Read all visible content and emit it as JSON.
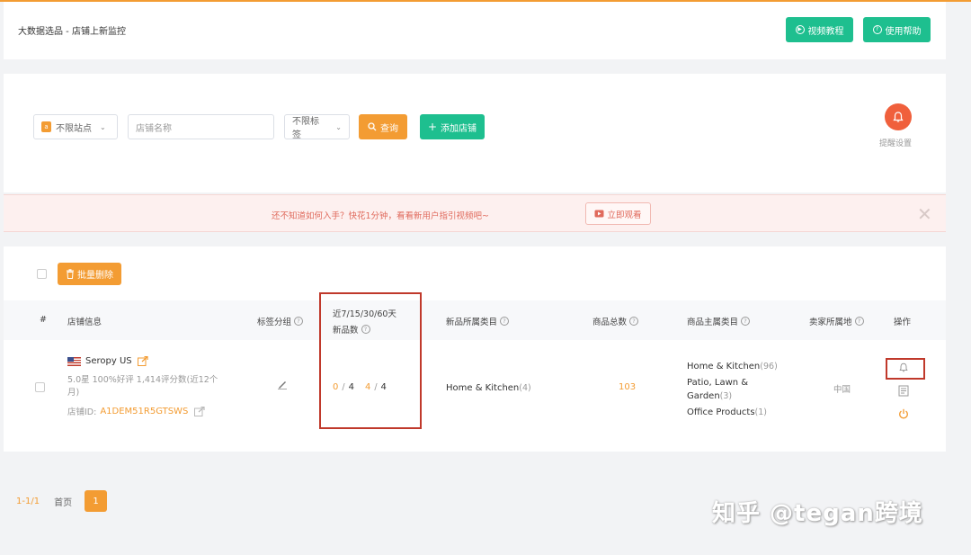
{
  "header": {
    "breadcrumb": "大数据选品 - 店铺上新监控",
    "video_tutorial": "视频教程",
    "help": "使用帮助"
  },
  "filter": {
    "site_select": "不限站点",
    "shop_name_placeholder": "店铺名称",
    "tag_select": "不限标签",
    "query_button": "查询",
    "add_shop_button": "添加店铺",
    "remind_label": "提醒设置"
  },
  "banner": {
    "text": "还不知道如何入手？快花1分钟，看看新用户指引视频吧~",
    "watch_button": "立即观看",
    "close": "✕"
  },
  "table": {
    "batch_delete": "批量删除",
    "headers": {
      "index": "#",
      "shop_info": "店铺信息",
      "tag_group": "标签分组",
      "new_count_line1": "近7/15/30/60天",
      "new_count_line2": "新品数",
      "new_category": "新品所属类目",
      "total": "商品总数",
      "main_category": "商品主属类目",
      "seller_location": "卖家所属地",
      "actions": "操作"
    },
    "rows": [
      {
        "shop_name": "Seropy US",
        "rating": "5.0星  100%好评  1,414评分数(近12个月)",
        "shop_id_label": "店铺ID:",
        "shop_id": "A1DEM51R5GTSWS",
        "new_7": "0",
        "new_15": "4",
        "new_30": "4",
        "new_60": "4",
        "new_category": "Home & Kitchen",
        "new_category_count": "(4)",
        "total": "103",
        "main_categories": [
          {
            "name": "Home & Kitchen",
            "count": "(96)"
          },
          {
            "name": "Patio, Lawn & Garden",
            "count": "(3)"
          },
          {
            "name": "Office Products",
            "count": "(1)"
          }
        ],
        "seller_location": "中国"
      }
    ]
  },
  "pagination": {
    "range": "1-1/1",
    "first": "首页",
    "current": "1"
  },
  "watermark": "知乎 @tegan跨境",
  "colors": {
    "accent_orange": "#f39c33",
    "green": "#1ebf8f",
    "red_highlight": "#c0392b"
  }
}
